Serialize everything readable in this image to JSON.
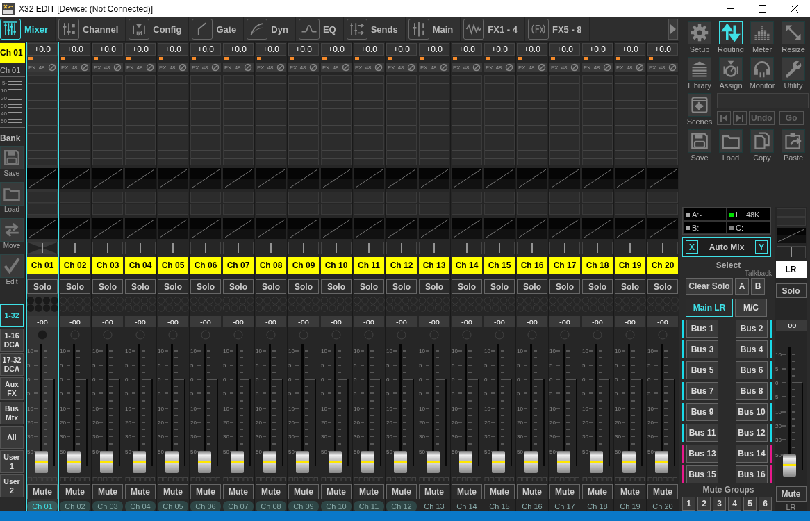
{
  "window": {
    "title": "X32 EDIT [Device: (Not Connected)]"
  },
  "tabs": [
    {
      "label": "Mixer",
      "selected": true
    },
    {
      "label": "Channel",
      "selected": false
    },
    {
      "label": "Config",
      "selected": false
    },
    {
      "label": "Gate",
      "selected": false
    },
    {
      "label": "Dyn",
      "selected": false
    },
    {
      "label": "EQ",
      "selected": false
    },
    {
      "label": "Sends",
      "selected": false
    },
    {
      "label": "Main",
      "selected": false
    },
    {
      "label": "FX1 - 4",
      "selected": false
    },
    {
      "label": "FX5 - 8",
      "selected": false
    }
  ],
  "sidebar": {
    "channel": "Ch 01",
    "channel_name": "Ch 01",
    "meter_scale": [
      "-5",
      "10",
      "20",
      "30",
      "40",
      "50"
    ],
    "bank_label": "Bank",
    "bank_buttons": [
      "Save",
      "Load",
      "Move",
      "Edit"
    ],
    "layers": [
      {
        "label": "1-32",
        "selected": true
      },
      {
        "label": "1-16 DCA",
        "selected": false
      },
      {
        "label": "17-32 DCA",
        "selected": false
      },
      {
        "label": "Aux FX",
        "selected": false
      },
      {
        "label": "Bus Mtx",
        "selected": false
      },
      {
        "label": "All",
        "selected": false
      },
      {
        "label": "User 1",
        "selected": false
      },
      {
        "label": "User 2",
        "selected": false
      }
    ]
  },
  "channels": [
    {
      "name": "Ch 01",
      "selected": true,
      "shaded": true,
      "gain": "+0.0",
      "fx": "FX",
      "phantom": "48",
      "solo": "Solo",
      "reading": "-oo",
      "scale": [
        "10",
        "5",
        "0",
        "5",
        "10",
        "20",
        "30",
        "50"
      ],
      "level": 0,
      "mute": "Mute",
      "label": "Ch 01"
    },
    {
      "name": "Ch 02",
      "selected": false,
      "shaded": true,
      "gain": "+0.0",
      "fx": "FX",
      "phantom": "48",
      "solo": "Solo",
      "reading": "-oo",
      "scale": [
        "10",
        "5",
        "0",
        "5",
        "10",
        "20",
        "30",
        "50"
      ],
      "level": 0,
      "mute": "Mute",
      "label": "Ch 02"
    },
    {
      "name": "Ch 03",
      "selected": false,
      "shaded": true,
      "gain": "+0.0",
      "fx": "FX",
      "phantom": "48",
      "solo": "Solo",
      "reading": "-oo",
      "scale": [
        "10",
        "5",
        "0",
        "5",
        "10",
        "20",
        "30",
        "50"
      ],
      "level": 0,
      "mute": "Mute",
      "label": "Ch 03"
    },
    {
      "name": "Ch 04",
      "selected": false,
      "shaded": true,
      "gain": "+0.0",
      "fx": "FX",
      "phantom": "48",
      "solo": "Solo",
      "reading": "-oo",
      "scale": [
        "10",
        "5",
        "0",
        "5",
        "10",
        "20",
        "30",
        "50"
      ],
      "level": 0,
      "mute": "Mute",
      "label": "Ch 04"
    },
    {
      "name": "Ch 05",
      "selected": false,
      "shaded": true,
      "gain": "+0.0",
      "fx": "FX",
      "phantom": "48",
      "solo": "Solo",
      "reading": "-oo",
      "scale": [
        "10",
        "5",
        "0",
        "5",
        "10",
        "20",
        "30",
        "50"
      ],
      "level": 0,
      "mute": "Mute",
      "label": "Ch 05"
    },
    {
      "name": "Ch 06",
      "selected": false,
      "shaded": true,
      "gain": "+0.0",
      "fx": "FX",
      "phantom": "48",
      "solo": "Solo",
      "reading": "-oo",
      "scale": [
        "10",
        "5",
        "0",
        "5",
        "10",
        "20",
        "30",
        "50"
      ],
      "level": 0,
      "mute": "Mute",
      "label": "Ch 06"
    },
    {
      "name": "Ch 07",
      "selected": false,
      "shaded": true,
      "gain": "+0.0",
      "fx": "FX",
      "phantom": "48",
      "solo": "Solo",
      "reading": "-oo",
      "scale": [
        "10",
        "5",
        "0",
        "5",
        "10",
        "20",
        "30",
        "50"
      ],
      "level": 0,
      "mute": "Mute",
      "label": "Ch 07"
    },
    {
      "name": "Ch 08",
      "selected": false,
      "shaded": true,
      "gain": "+0.0",
      "fx": "FX",
      "phantom": "48",
      "solo": "Solo",
      "reading": "-oo",
      "scale": [
        "10",
        "5",
        "0",
        "5",
        "10",
        "20",
        "30",
        "50"
      ],
      "level": 0,
      "mute": "Mute",
      "label": "Ch 08"
    },
    {
      "name": "Ch 09",
      "selected": false,
      "shaded": true,
      "gain": "+0.0",
      "fx": "FX",
      "phantom": "48",
      "solo": "Solo",
      "reading": "-oo",
      "scale": [
        "10",
        "5",
        "0",
        "5",
        "10",
        "20",
        "30",
        "50"
      ],
      "level": 0,
      "mute": "Mute",
      "label": "Ch 09"
    },
    {
      "name": "Ch 10",
      "selected": false,
      "shaded": true,
      "gain": "+0.0",
      "fx": "FX",
      "phantom": "48",
      "solo": "Solo",
      "reading": "-oo",
      "scale": [
        "10",
        "5",
        "0",
        "5",
        "10",
        "20",
        "30",
        "50"
      ],
      "level": 0,
      "mute": "Mute",
      "label": "Ch 10"
    },
    {
      "name": "Ch 11",
      "selected": false,
      "shaded": true,
      "gain": "+0.0",
      "fx": "FX",
      "phantom": "48",
      "solo": "Solo",
      "reading": "-oo",
      "scale": [
        "10",
        "5",
        "0",
        "5",
        "10",
        "20",
        "30",
        "50"
      ],
      "level": 0,
      "mute": "Mute",
      "label": "Ch 11"
    },
    {
      "name": "Ch 12",
      "selected": false,
      "shaded": true,
      "gain": "+0.0",
      "fx": "FX",
      "phantom": "48",
      "solo": "Solo",
      "reading": "-oo",
      "scale": [
        "10",
        "5",
        "0",
        "5",
        "10",
        "20",
        "30",
        "50"
      ],
      "level": 0,
      "mute": "Mute",
      "label": "Ch 12"
    },
    {
      "name": "Ch 13",
      "selected": false,
      "shaded": false,
      "gain": "+0.0",
      "fx": "FX",
      "phantom": "48",
      "solo": "Solo",
      "reading": "-oo",
      "scale": [
        "10",
        "5",
        "0",
        "5",
        "10",
        "20",
        "30",
        "50"
      ],
      "level": 0,
      "mute": "Mute",
      "label": "Ch 13"
    },
    {
      "name": "Ch 14",
      "selected": false,
      "shaded": false,
      "gain": "+0.0",
      "fx": "FX",
      "phantom": "48",
      "solo": "Solo",
      "reading": "-oo",
      "scale": [
        "10",
        "5",
        "0",
        "5",
        "10",
        "20",
        "30",
        "50"
      ],
      "level": 0,
      "mute": "Mute",
      "label": "Ch 14"
    },
    {
      "name": "Ch 15",
      "selected": false,
      "shaded": false,
      "gain": "+0.0",
      "fx": "FX",
      "phantom": "48",
      "solo": "Solo",
      "reading": "-oo",
      "scale": [
        "10",
        "5",
        "0",
        "5",
        "10",
        "20",
        "30",
        "50"
      ],
      "level": 0,
      "mute": "Mute",
      "label": "Ch 15"
    },
    {
      "name": "Ch 16",
      "selected": false,
      "shaded": false,
      "gain": "+0.0",
      "fx": "FX",
      "phantom": "48",
      "solo": "Solo",
      "reading": "-oo",
      "scale": [
        "10",
        "5",
        "0",
        "5",
        "10",
        "20",
        "30",
        "50"
      ],
      "level": 0,
      "mute": "Mute",
      "label": "Ch 16"
    },
    {
      "name": "Ch 17",
      "selected": false,
      "shaded": false,
      "gain": "+0.0",
      "fx": "FX",
      "phantom": "48",
      "solo": "Solo",
      "reading": "-oo",
      "scale": [
        "10",
        "5",
        "0",
        "5",
        "10",
        "20",
        "30",
        "50"
      ],
      "level": 0,
      "mute": "Mute",
      "label": "Ch 17"
    },
    {
      "name": "Ch 18",
      "selected": false,
      "shaded": false,
      "gain": "+0.0",
      "fx": "FX",
      "phantom": "48",
      "solo": "Solo",
      "reading": "-oo",
      "scale": [
        "10",
        "5",
        "0",
        "5",
        "10",
        "20",
        "30",
        "50"
      ],
      "level": 0,
      "mute": "Mute",
      "label": "Ch 18"
    },
    {
      "name": "Ch 19",
      "selected": false,
      "shaded": false,
      "gain": "+0.0",
      "fx": "FX",
      "phantom": "48",
      "solo": "Solo",
      "reading": "-oo",
      "scale": [
        "10",
        "5",
        "0",
        "5",
        "10",
        "20",
        "30",
        "50"
      ],
      "level": 0,
      "mute": "Mute",
      "label": "Ch 19"
    },
    {
      "name": "Ch 20",
      "selected": false,
      "shaded": false,
      "gain": "+0.0",
      "fx": "FX",
      "phantom": "48",
      "solo": "Solo",
      "reading": "-oo",
      "scale": [
        "10",
        "5",
        "0",
        "5",
        "10",
        "20",
        "30",
        "50"
      ],
      "level": 0,
      "mute": "Mute",
      "label": "Ch 20"
    }
  ],
  "tools": [
    {
      "label": "Setup",
      "selected": false
    },
    {
      "label": "Routing",
      "selected": true
    },
    {
      "label": "Meter",
      "selected": false
    },
    {
      "label": "Resize",
      "selected": false
    },
    {
      "label": "Library",
      "selected": false
    },
    {
      "label": "Assign",
      "selected": false
    },
    {
      "label": "Monitor",
      "selected": false
    },
    {
      "label": "Utility",
      "selected": false
    }
  ],
  "scenes": {
    "label": "Scenes",
    "undo": "Undo",
    "go": "Go"
  },
  "files": [
    "Save",
    "Load",
    "Copy",
    "Paste"
  ],
  "status": [
    {
      "label": "A:-",
      "color": "#a8a8a8"
    },
    {
      "label": "L   48K",
      "color": "#00e000"
    },
    {
      "label": "B:-",
      "color": "#a8a8a8"
    },
    {
      "label": "C:-",
      "color": "#808080"
    }
  ],
  "automix": {
    "x": "X",
    "label": "Auto Mix",
    "y": "Y"
  },
  "select": {
    "heading": "Select",
    "talkback_label": "Talkback",
    "clear_solo": "Clear Solo",
    "talkback": [
      "A",
      "B"
    ],
    "main": [
      {
        "label": "Main LR",
        "selected": true
      },
      {
        "label": "M/C",
        "selected": false
      }
    ],
    "buses": [
      {
        "label": "Bus 1",
        "color": "#19d9e8"
      },
      {
        "label": "Bus 2",
        "color": "#19d9e8"
      },
      {
        "label": "Bus 3",
        "color": "#19d9e8"
      },
      {
        "label": "Bus 4",
        "color": "#19d9e8"
      },
      {
        "label": "Bus 5",
        "color": "#19d9e8"
      },
      {
        "label": "Bus 6",
        "color": "#19d9e8"
      },
      {
        "label": "Bus 7",
        "color": "#19d9e8"
      },
      {
        "label": "Bus 8",
        "color": "#19d9e8"
      },
      {
        "label": "Bus 9",
        "color": "#19d9e8"
      },
      {
        "label": "Bus 10",
        "color": "#19d9e8"
      },
      {
        "label": "Bus 11",
        "color": "#19d9e8"
      },
      {
        "label": "Bus 12",
        "color": "#19d9e8"
      },
      {
        "label": "Bus 13",
        "color": "#e8198c"
      },
      {
        "label": "Bus 14",
        "color": "#e8198c"
      },
      {
        "label": "Bus 15",
        "color": "#e8198c"
      },
      {
        "label": "Bus 16",
        "color": "#e8198c"
      }
    ]
  },
  "mute_groups": {
    "heading": "Mute Groups",
    "buttons": [
      "1",
      "2",
      "3",
      "4",
      "5",
      "6"
    ]
  },
  "main_strip": {
    "name": "LR",
    "solo": "Solo",
    "reading": "-oo",
    "scale": [
      "10",
      "5",
      "0",
      "5",
      "10",
      "20",
      "30",
      "50"
    ],
    "level": 0,
    "mute": "Mute",
    "label": "LR"
  }
}
